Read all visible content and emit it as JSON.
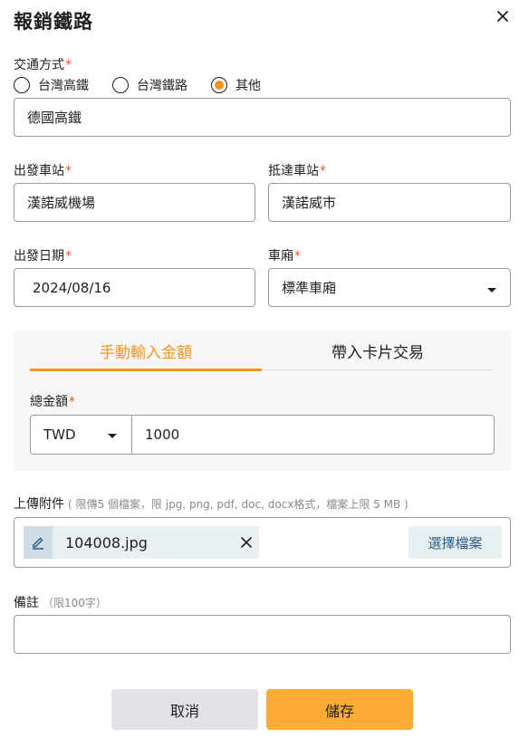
{
  "dialog": {
    "title": "報銷鐵路"
  },
  "transport": {
    "label": "交通方式",
    "options": [
      {
        "label": "台灣高鐵",
        "selected": false
      },
      {
        "label": "台灣鐵路",
        "selected": false
      },
      {
        "label": "其他",
        "selected": true
      }
    ],
    "other_value": "德國高鐵"
  },
  "departure_station": {
    "label": "出發車站",
    "value": "漢諾威機場"
  },
  "arrival_station": {
    "label": "抵達車站",
    "value": "漢諾威市"
  },
  "departure_date": {
    "label": "出發日期",
    "value": "2024/08/16"
  },
  "car_class": {
    "label": "車廂",
    "value": "標準車廂"
  },
  "amount_panel": {
    "tabs": [
      {
        "label": "手動輸入金額",
        "active": true
      },
      {
        "label": "帶入卡片交易",
        "active": false
      }
    ],
    "total_label": "總金額",
    "currency": "TWD",
    "amount": "1000"
  },
  "attachment": {
    "label": "上傳附件",
    "hint": "( 限傳5 個檔案，限 jpg, png, pdf, doc, docx格式，檔案上限 5 MB )",
    "file_name": "104008.jpg",
    "choose_label": "選擇檔案"
  },
  "remark": {
    "label": "備註",
    "hint": "（限100字）",
    "value": ""
  },
  "actions": {
    "cancel_label": "取消",
    "save_label": "儲存"
  },
  "colors": {
    "accent": "#f7941d",
    "save_button": "#fbac37",
    "required": "#e8542b",
    "link": "#2b5d86"
  }
}
